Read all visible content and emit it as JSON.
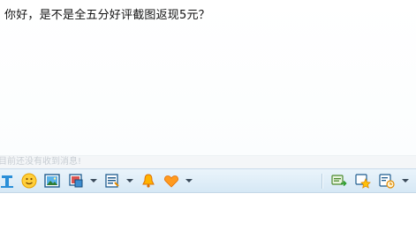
{
  "chat": {
    "message": "你好，是不是全五分好评截图返现5元？"
  },
  "status": {
    "text": "目前还没有收到消息!"
  },
  "toolbar": {
    "left_icons": [
      "font-icon",
      "emoji-icon",
      "image-icon",
      "screenshot-icon",
      "quick-reply-icon",
      "shake-icon",
      "heart-icon"
    ],
    "right_icons": [
      "send-file-icon",
      "favorite-icon",
      "history-icon"
    ],
    "accent_color": "#d6e8f5"
  }
}
